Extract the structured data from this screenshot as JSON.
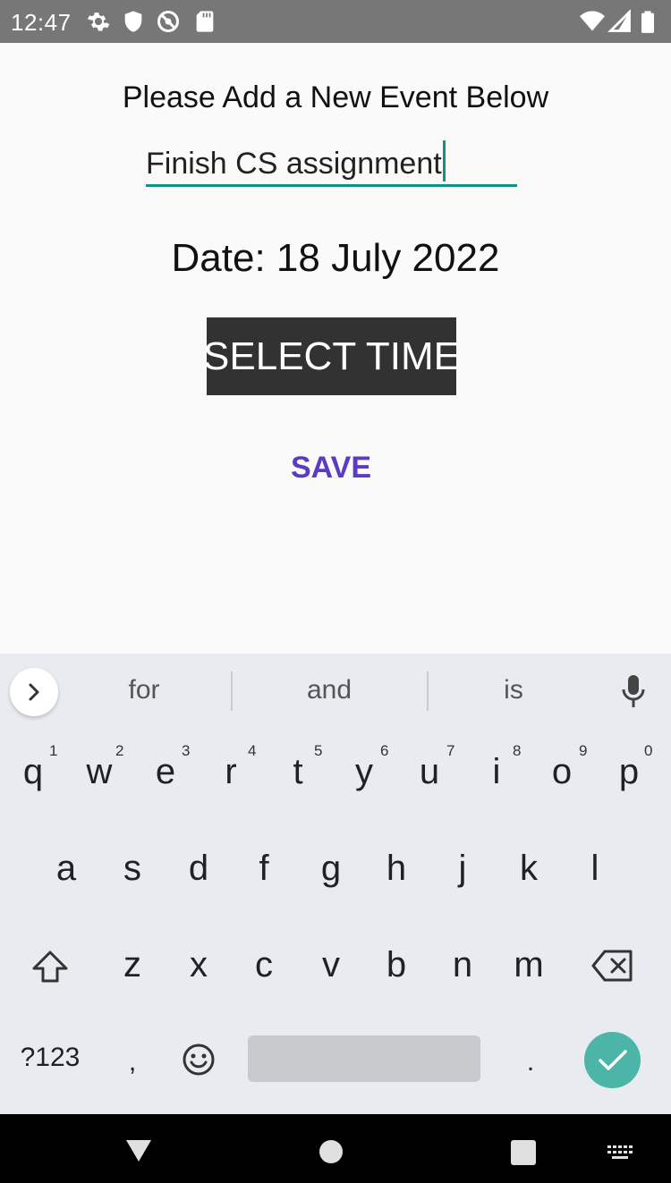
{
  "status_bar": {
    "time": "12:47",
    "icons": [
      "gear-icon",
      "shield-icon",
      "no-sync-icon",
      "sd-card-icon",
      "wifi-icon",
      "cell-signal-icon",
      "battery-icon"
    ]
  },
  "app": {
    "heading": "Please Add a New Event Below",
    "event_input_value": "Finish CS assignment",
    "date_label": "Date: 18 July 2022",
    "select_time_label": "SELECT TIME",
    "save_label": "SAVE",
    "accent_color": "#148f83",
    "save_color": "#5a3bc4"
  },
  "keyboard": {
    "suggestions": [
      "for",
      "and",
      "is"
    ],
    "row1": [
      "q",
      "w",
      "e",
      "r",
      "t",
      "y",
      "u",
      "i",
      "o",
      "p"
    ],
    "row1_numbers": [
      "1",
      "2",
      "3",
      "4",
      "5",
      "6",
      "7",
      "8",
      "9",
      "0"
    ],
    "row2": [
      "a",
      "s",
      "d",
      "f",
      "g",
      "h",
      "j",
      "k",
      "l"
    ],
    "row3": [
      "z",
      "x",
      "c",
      "v",
      "b",
      "n",
      "m"
    ],
    "symbols_label": "?123",
    "comma": ",",
    "period": "."
  }
}
